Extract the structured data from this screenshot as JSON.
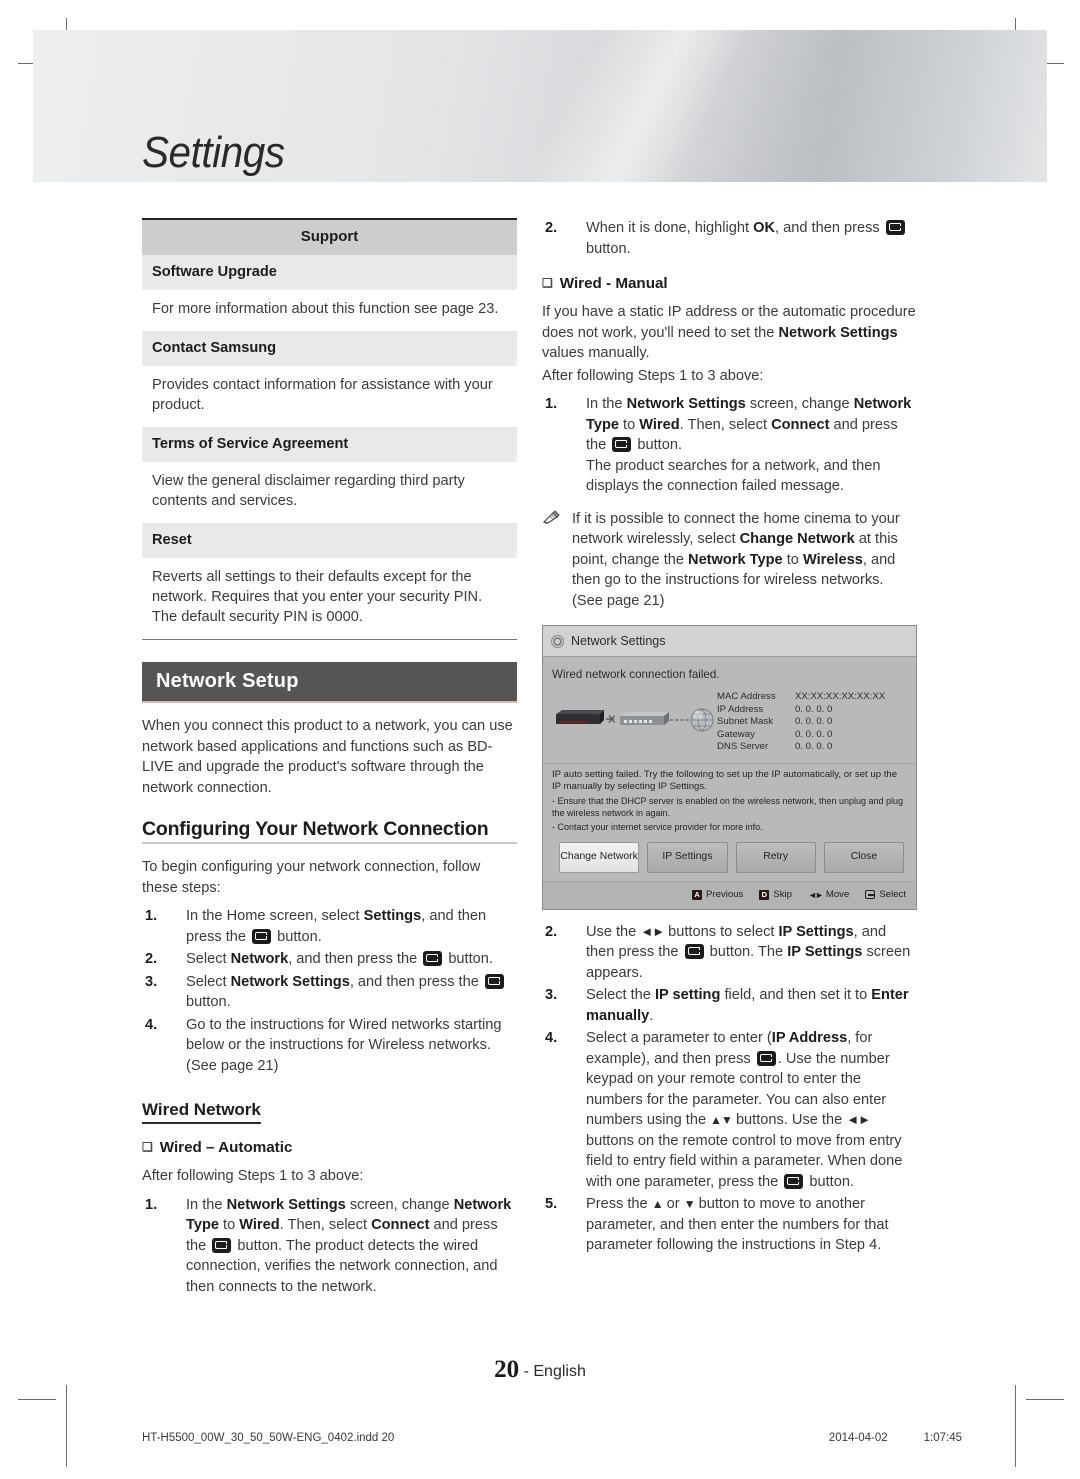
{
  "page": {
    "banner_title": "Settings",
    "footer_page_number": "20",
    "footer_language": "- English",
    "print_file": "HT-H5500_00W_30_50_50W-ENG_0402.indd   20",
    "print_date": "2014-04-02",
    "print_time": "1:07:45"
  },
  "support_table": {
    "header": "Support",
    "rows": [
      {
        "title": "Software Upgrade",
        "body": "For more information about this function see page 23."
      },
      {
        "title": "Contact Samsung",
        "body": "Provides contact information for assistance with your product."
      },
      {
        "title": "Terms of Service Agreement",
        "body": "View the general disclaimer regarding third party contents and services."
      },
      {
        "title": "Reset",
        "body": "Reverts all settings to their defaults except for the network. Requires that you enter your security PIN. The default security PIN is 0000."
      }
    ]
  },
  "network_setup": {
    "section_title": "Network Setup",
    "intro": "When you connect this product to a network, you can use network based applications and functions such as BD-LIVE and upgrade the product's software through the network connection.",
    "subsection_title": "Configuring Your Network Connection",
    "subsection_intro": "To begin configuring your network connection, follow these steps:",
    "steps": [
      {
        "num": "1.",
        "before": "In the Home screen, select ",
        "bold": "Settings",
        "after": ", and then press the ",
        "icon": "enter-button-icon",
        "tail": " button."
      },
      {
        "num": "2.",
        "before": "Select ",
        "bold": "Network",
        "after": ", and then press the ",
        "icon": "enter-button-icon",
        "tail": " button."
      },
      {
        "num": "3.",
        "before": "Select ",
        "bold": "Network Settings",
        "after": ", and then press the ",
        "icon": "enter-button-icon",
        "tail": " button."
      },
      {
        "num": "4.",
        "before": "Go to the instructions for Wired networks starting below or the instructions for Wireless networks. (See page 21)",
        "bold": "",
        "after": "",
        "icon": "",
        "tail": ""
      }
    ]
  },
  "wired_network": {
    "heading": "Wired Network",
    "automatic": {
      "title": "Wired – Automatic",
      "lead": "After following Steps 1 to 3 above:",
      "step1_num": "1.",
      "step1_a": "In the ",
      "step1_b1": "Network Settings",
      "step1_c": " screen, change ",
      "step1_b2": "Network Type",
      "step1_d": " to ",
      "step1_b3": "Wired",
      "step1_e": ". Then, select ",
      "step1_b4": "Connect",
      "step1_f": " and press the ",
      "step1_g": " button. The product detects the wired connection, verifies the network connection, and then connects to the network.",
      "step2_num": "2.",
      "step2_a": "When it is done, highlight ",
      "step2_b": "OK",
      "step2_c": ", and then press ",
      "step2_d": " button."
    },
    "manual": {
      "title": "Wired - Manual",
      "lead1_a": "If you have a static IP address or the automatic procedure does not work, you'll need to set the ",
      "lead1_b": "Network Settings",
      "lead1_c": " values manually.",
      "lead2": "After following Steps 1 to 3 above:",
      "step1_num": "1.",
      "step1_a": "In the ",
      "step1_b1": "Network Settings",
      "step1_c": " screen, change ",
      "step1_b2": "Network Type",
      "step1_d": " to ",
      "step1_b3": "Wired",
      "step1_e": ". Then, select ",
      "step1_b4": "Connect",
      "step1_f": " and press the ",
      "step1_g": " button.",
      "step1_h": "The product searches for a network, and then displays the connection failed message.",
      "note_a": "If it is possible to connect the home cinema to your network wirelessly, select ",
      "note_b1": "Change Network",
      "note_c": " at this point, change the ",
      "note_b2": "Network Type",
      "note_d": " to ",
      "note_b3": "Wireless",
      "note_e": ", and then go to the instructions for wireless networks. (See page 21)",
      "step2_num": "2.",
      "step2_a": "Use the ",
      "step2_arrows": "◄►",
      "step2_b": " buttons to select ",
      "step2_b1": "IP Settings",
      "step2_c": ", and then press the ",
      "step2_d": " button. The ",
      "step2_b2": "IP Settings",
      "step2_e": " screen appears.",
      "step3_num": "3.",
      "step3_a": "Select the ",
      "step3_b1": "IP setting",
      "step3_c": " field, and then set it to ",
      "step3_b2": "Enter manually",
      "step3_d": ".",
      "step4_num": "4.",
      "step4_a": "Select a parameter to enter (",
      "step4_b1": "IP Address",
      "step4_c": ", for example), and then press ",
      "step4_d": ". Use the number keypad on your remote control to enter the numbers for the parameter. You can also enter numbers using the ",
      "step4_arrows_ud": "▲▼",
      "step4_e": " buttons. Use the ",
      "step4_arrows_lr": "◄►",
      "step4_f": " buttons on the remote control to move from entry field to entry field within a parameter. When done with one parameter, press the ",
      "step4_g": " button.",
      "step5_num": "5.",
      "step5_a": "Press the ",
      "step5_up": "▲",
      "step5_b": " or ",
      "step5_down": "▼",
      "step5_c": " button to move to another parameter, and then enter the numbers for that parameter following the instructions in Step 4."
    }
  },
  "screenshot": {
    "title": "Network Settings",
    "failed_message": "Wired network connection failed.",
    "info_rows": [
      {
        "label": "MAC Address",
        "value": "XX:XX:XX:XX:XX:XX"
      },
      {
        "label": "IP Address",
        "value": "0.  0.  0.  0"
      },
      {
        "label": "Subnet Mask",
        "value": "0.  0.  0.  0"
      },
      {
        "label": "Gateway",
        "value": "0.  0.  0.  0"
      },
      {
        "label": "DNS Server",
        "value": "0.  0.  0.  0"
      }
    ],
    "message_main": "IP auto setting failed. Try the following to set up the IP automatically, or set up the IP manually by selecting IP Settings.",
    "message_bullet1": "- Ensure that the DHCP server is enabled on the wireless network, then unplug and plug the wireless network in again.",
    "message_bullet2": "- Contact your internet service provider for more info.",
    "buttons": [
      {
        "label": "Change Network",
        "selected": true
      },
      {
        "label": "IP Settings",
        "selected": false
      },
      {
        "label": "Retry",
        "selected": false
      },
      {
        "label": "Close",
        "selected": false
      }
    ],
    "footer_hints": [
      {
        "key": "A",
        "label": "Previous"
      },
      {
        "key": "D",
        "label": "Skip"
      },
      {
        "key": "",
        "label": "Move"
      },
      {
        "key": "",
        "label": "Select"
      }
    ]
  }
}
